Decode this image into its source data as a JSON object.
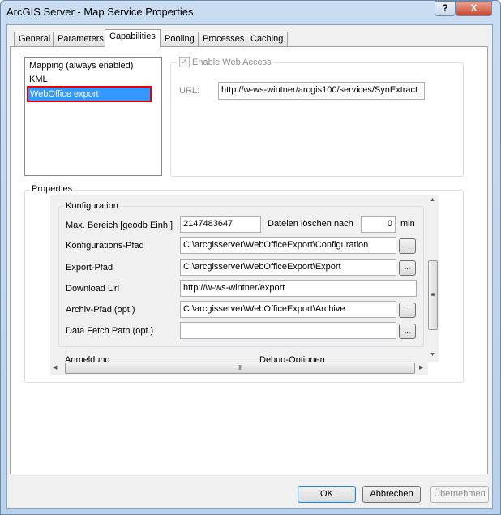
{
  "window": {
    "title": "ArcGIS Server - Map Service Properties",
    "help": "?",
    "close": "X"
  },
  "tabs": [
    "General",
    "Parameters",
    "Capabilities",
    "Pooling",
    "Processes",
    "Caching"
  ],
  "capabilities": [
    "Mapping (always enabled)",
    "KML",
    "WebOffice export"
  ],
  "web_access": {
    "label": "Enable Web Access",
    "checked": true,
    "url_label": "URL:",
    "url": "http://w-ws-wintner/arcgis100/services/SynExtract"
  },
  "properties": {
    "title": "Properties",
    "group": "Konfiguration",
    "max_label": "Max. Bereich [geodb Einh.]",
    "max_value": "2147483647",
    "delete_label": "Dateien löschen nach",
    "delete_value": "0",
    "delete_unit": "min",
    "config_label": "Konfigurations-Pfad",
    "config_value": "C:\\arcgisserver\\WebOfficeExport\\Configuration",
    "export_label": "Export-Pfad",
    "export_value": "C:\\arcgisserver\\WebOfficeExport\\Export",
    "download_label": "Download Url",
    "download_value": "http://w-ws-wintner/export",
    "archive_label": "Archiv-Pfad (opt.)",
    "archive_value": "C:\\arcgisserver\\WebOfficeExport\\Archive",
    "fetch_label": "Data Fetch Path (opt.)",
    "fetch_value": "",
    "browse": "...",
    "next_group1": "Anmeldung",
    "next_group2": "Debug-Optionen"
  },
  "buttons": {
    "ok": "OK",
    "cancel": "Abbrechen",
    "apply": "Übernehmen"
  }
}
